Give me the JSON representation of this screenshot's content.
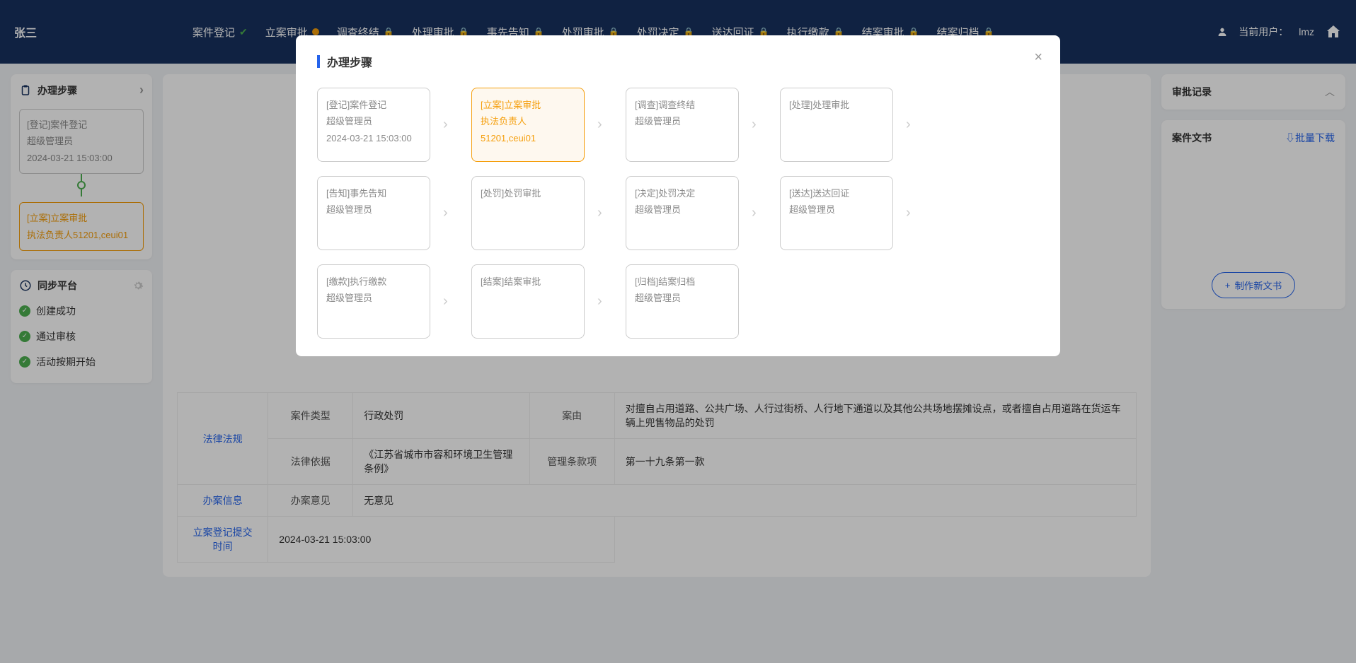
{
  "header": {
    "user_name": "张三",
    "tabs": [
      {
        "label": "案件登记",
        "icon": "check"
      },
      {
        "label": "立案审批",
        "icon": "dot-orange"
      },
      {
        "label": "调查终结",
        "icon": "lock"
      },
      {
        "label": "处理审批",
        "icon": "lock"
      },
      {
        "label": "事先告知",
        "icon": "lock"
      },
      {
        "label": "处罚审批",
        "icon": "lock"
      },
      {
        "label": "处罚决定",
        "icon": "lock"
      },
      {
        "label": "送达回证",
        "icon": "lock"
      },
      {
        "label": "执行缴款",
        "icon": "lock"
      },
      {
        "label": "结案审批",
        "icon": "lock"
      },
      {
        "label": "结案归档",
        "icon": "lock"
      }
    ],
    "current_user_label": "当前用户：",
    "current_user": "lmz"
  },
  "sidebar": {
    "steps_title": "办理步骤",
    "step1": {
      "title": "[登记]案件登记",
      "owner": "超级管理员",
      "time": "2024-03-21 15:03:00"
    },
    "step2": {
      "title": "[立案]立案审批",
      "owner": "执法负责人51201,ceui01"
    },
    "sync_title": "同步平台",
    "sync_items": [
      "创建成功",
      "通过审核",
      "活动按期开始"
    ]
  },
  "content": {
    "rows": [
      {
        "section": "法律法规",
        "field1": "案件类型",
        "value1": "行政处罚",
        "field2": "案由",
        "value2": "对擅自占用道路、公共广场、人行过街桥、人行地下通道以及其他公共场地摆摊设点，或者擅自占用道路在货运车辆上兜售物品的处罚"
      },
      {
        "section": "",
        "field1": "法律依据",
        "value1": "《江苏省城市市容和环境卫生管理条例》",
        "field2": "管理条款项",
        "value2": "第一十九条第一款"
      },
      {
        "section": "办案信息",
        "field1": "办案意见",
        "value1": "无意见",
        "field2": "",
        "value2": ""
      },
      {
        "section": "立案登记提交时间",
        "field1": "",
        "value1": "2024-03-21 15:03:00",
        "field2": "",
        "value2": ""
      }
    ]
  },
  "right": {
    "approval_title": "审批记录",
    "doc_title": "案件文书",
    "batch_download": "批量下载",
    "new_doc_label": "制作新文书"
  },
  "modal": {
    "title": "办理步骤",
    "steps": [
      {
        "title": "[登记]案件登记",
        "owner": "超级管理员",
        "time": "2024-03-21 15:03:00",
        "state": "done",
        "arrow": true
      },
      {
        "title": "[立案]立案审批",
        "owner": "执法负责人51201,ceui01",
        "time": "",
        "state": "active",
        "arrow": true
      },
      {
        "title": "[调查]调查终结",
        "owner": "超级管理员",
        "time": "",
        "state": "pending",
        "arrow": true
      },
      {
        "title": "[处理]处理审批",
        "owner": "",
        "time": "",
        "state": "pending",
        "arrow": true
      },
      {
        "title": "[告知]事先告知",
        "owner": "超级管理员",
        "time": "",
        "state": "pending",
        "arrow": true
      },
      {
        "title": "[处罚]处罚审批",
        "owner": "",
        "time": "",
        "state": "pending",
        "arrow": true
      },
      {
        "title": "[决定]处罚决定",
        "owner": "超级管理员",
        "time": "",
        "state": "pending",
        "arrow": true
      },
      {
        "title": "[送达]送达回证",
        "owner": "超级管理员",
        "time": "",
        "state": "pending",
        "arrow": true
      },
      {
        "title": "[缴款]执行缴款",
        "owner": "超级管理员",
        "time": "",
        "state": "pending",
        "arrow": true
      },
      {
        "title": "[结案]结案审批",
        "owner": "",
        "time": "",
        "state": "pending",
        "arrow": true
      },
      {
        "title": "[归档]结案归档",
        "owner": "超级管理员",
        "time": "",
        "state": "pending",
        "arrow": false
      }
    ]
  }
}
